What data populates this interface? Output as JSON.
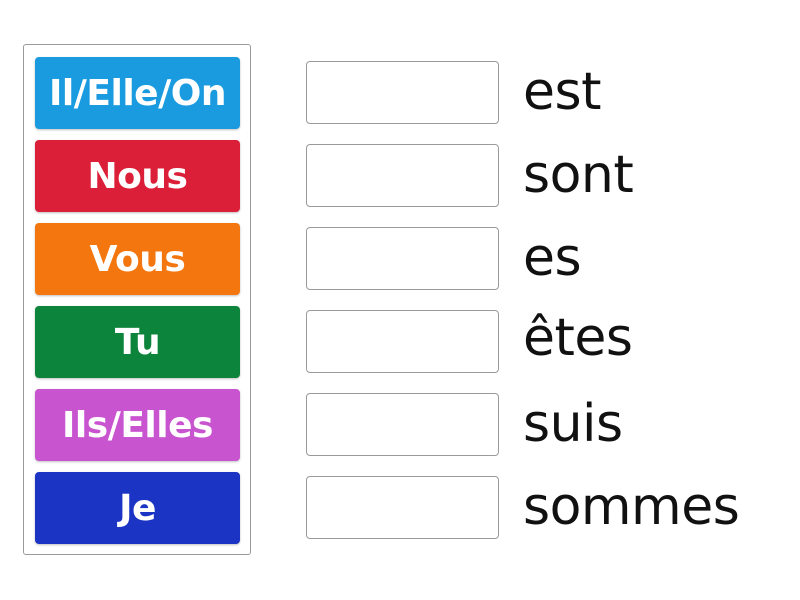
{
  "activity": {
    "tiles": [
      {
        "label": "Il/Elle/On",
        "color": "#1a9be0"
      },
      {
        "label": "Nous",
        "color": "#dc1f38"
      },
      {
        "label": "Vous",
        "color": "#f4760e"
      },
      {
        "label": "Tu",
        "color": "#0c843b"
      },
      {
        "label": "Ils/Elles",
        "color": "#c954d0"
      },
      {
        "label": "Je",
        "color": "#1c34c4"
      }
    ],
    "targets": [
      {
        "slot_value": "",
        "word": "est"
      },
      {
        "slot_value": "",
        "word": "sont"
      },
      {
        "slot_value": "",
        "word": "es"
      },
      {
        "slot_value": "",
        "word": "êtes"
      },
      {
        "slot_value": "",
        "word": "suis"
      },
      {
        "slot_value": "",
        "word": "sommes"
      }
    ]
  }
}
